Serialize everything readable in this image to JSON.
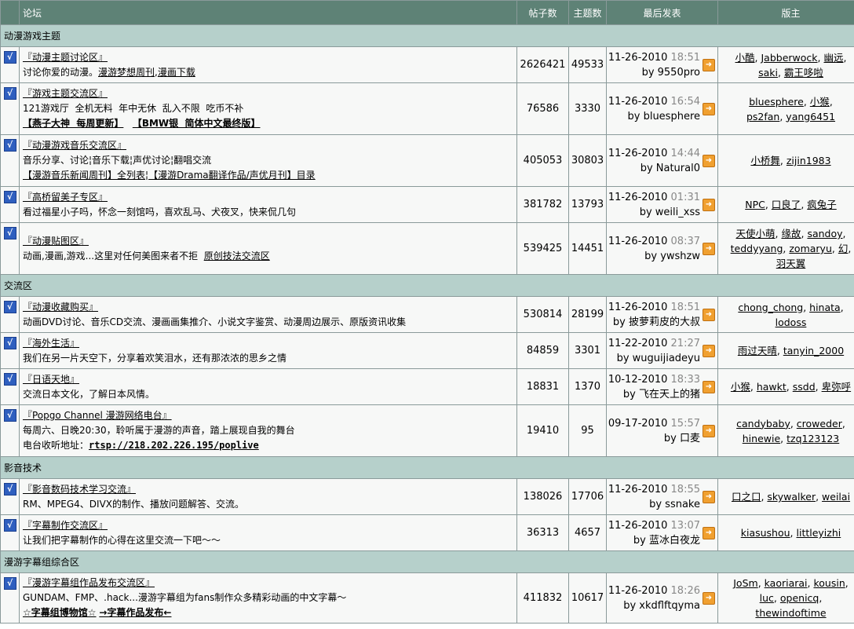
{
  "header": {
    "forum": "论坛",
    "posts": "帖子数",
    "topics": "主题数",
    "last_post": "最后发表",
    "moderators": "版主"
  },
  "sections": [
    {
      "title": "动漫游戏主题",
      "forums": [
        {
          "name": "『动漫主题讨论区』",
          "lines": [
            [
              {
                "t": "讨论你爱的动漫。"
              },
              {
                "t": "漫游梦想周刊",
                "link": true
              },
              {
                "t": ","
              },
              {
                "t": "漫画下载",
                "link": true
              }
            ]
          ],
          "posts": "2626421",
          "topics": "49533",
          "date": "11-26-2010",
          "time": "18:51",
          "by": "by 9550pro",
          "mods": [
            [
              "小酷",
              "Jabberwock",
              "幽远"
            ],
            [
              "saki",
              "霸王哆啦"
            ]
          ]
        },
        {
          "name": "『游戏主题交流区』",
          "lines": [
            [
              {
                "t": "121游戏厅  全机无料  年中无休  乱入不限  吃币不补"
              }
            ],
            [
              {
                "t": "【燕子大神  每周更新】",
                "style": "red"
              },
              {
                "t": "   "
              },
              {
                "t": "【BMW银  简体中文最终版】",
                "style": "blue"
              }
            ]
          ],
          "posts": "76586",
          "topics": "3330",
          "date": "11-26-2010",
          "time": "16:54",
          "by": "by bluesphere",
          "mods": [
            [
              "bluesphere",
              "小猴"
            ],
            [
              "ps2fan",
              "yang6451"
            ]
          ]
        },
        {
          "name": "『动漫游戏音乐交流区』",
          "lines": [
            [
              {
                "t": "音乐分享、讨论¦音乐下载¦声优讨论¦翻唱交流"
              }
            ],
            [
              {
                "t": "【漫游音乐新闻周刊】全列表",
                "link": true
              },
              {
                "t": "¦"
              },
              {
                "t": "【漫游Drama翻译作品/声优月刊】目录",
                "link": true
              }
            ]
          ],
          "posts": "405053",
          "topics": "30803",
          "date": "11-26-2010",
          "time": "14:44",
          "by": "by Natural0",
          "mods": [
            [
              "小桥舞",
              "zijin1983"
            ]
          ]
        },
        {
          "name": "『高桥留美子专区』",
          "lines": [
            [
              {
                "t": "看过福星小子吗，怀念一刻馆吗，喜欢乱马、犬夜叉，快来侃几句"
              }
            ]
          ],
          "posts": "381782",
          "topics": "13793",
          "date": "11-26-2010",
          "time": "01:31",
          "by": "by weili_xss",
          "mods": [
            [
              "NPC",
              "口良了",
              "疯兔子"
            ]
          ]
        },
        {
          "name": "『动漫贴图区』",
          "lines": [
            [
              {
                "t": "动画,漫画,游戏...这里对任何美图来者不拒  "
              },
              {
                "t": "原创技法交流区",
                "style": "darkred"
              }
            ]
          ],
          "posts": "539425",
          "topics": "14451",
          "date": "11-26-2010",
          "time": "08:37",
          "by": "by ywshzw",
          "mods": [
            [
              "天使小萌",
              "缘故",
              "sandoy"
            ],
            [
              "teddyyang",
              "zomaryu",
              "幻"
            ],
            [
              "羽天翼"
            ]
          ]
        }
      ]
    },
    {
      "title": "交流区",
      "forums": [
        {
          "name": "『动漫收藏购买』",
          "lines": [
            [
              {
                "t": "动画DVD讨论、音乐CD交流、漫画画集推介、小说文字鉴赏、动漫周边展示、原版资讯收集"
              }
            ]
          ],
          "posts": "530814",
          "topics": "28199",
          "date": "11-26-2010",
          "time": "18:51",
          "by": "by 披萝莉皮的大叔",
          "mods": [
            [
              "chong_chong",
              "hinata"
            ],
            [
              "lodoss"
            ]
          ]
        },
        {
          "name": "『海外生活』",
          "lines": [
            [
              {
                "t": "我们在另一片天空下，分享着欢笑泪水，还有那浓浓的思乡之情"
              }
            ]
          ],
          "posts": "84859",
          "topics": "3301",
          "date": "11-22-2010",
          "time": "21:27",
          "by": "by wuguijiadeyu",
          "mods": [
            [
              "雨过天晴",
              "tanyin_2000"
            ]
          ]
        },
        {
          "name": "『日语天地』",
          "lines": [
            [
              {
                "t": "交流日本文化，了解日本风情。"
              }
            ]
          ],
          "posts": "18831",
          "topics": "1370",
          "date": "10-12-2010",
          "time": "18:33",
          "by": "by 飞在天上的猪",
          "mods": [
            [
              "小猴",
              "hawkt",
              "ssdd",
              "卑弥呼"
            ]
          ]
        },
        {
          "name": "『Popgo Channel 漫游网络电台』",
          "lines": [
            [
              {
                "t": "每周六、日晚20:30，聆听属于漫游的声音，踏上展现自我的舞台"
              }
            ],
            [
              {
                "t": "电台收听地址："
              },
              {
                "t": "rtsp://218.202.226.195/poplive",
                "style": "pink"
              }
            ]
          ],
          "posts": "19410",
          "topics": "95",
          "date": "09-17-2010",
          "time": "15:57",
          "by": "by 口麦",
          "mods": [
            [
              "candybaby",
              "croweder"
            ],
            [
              "hinewie",
              "tzq123123"
            ]
          ]
        }
      ]
    },
    {
      "title": "影音技术",
      "forums": [
        {
          "name": "『影音数码技术学习交流』",
          "lines": [
            [
              {
                "t": "RM、MPEG4、DIVX的制作、播放问题解答、交流。"
              }
            ]
          ],
          "posts": "138026",
          "topics": "17706",
          "date": "11-26-2010",
          "time": "18:55",
          "by": "by ssnake",
          "mods": [
            [
              "口之口",
              "skywalker",
              "weilai"
            ]
          ]
        },
        {
          "name": "『字幕制作交流区』",
          "lines": [
            [
              {
                "t": "让我们把字幕制作的心得在这里交流一下吧～～"
              }
            ]
          ],
          "posts": "36313",
          "topics": "4657",
          "date": "11-26-2010",
          "time": "13:07",
          "by": "by 蓝冰白夜龙",
          "mods": [
            [
              "kiasushou",
              "littleyizhi"
            ]
          ]
        }
      ]
    },
    {
      "title": "漫游字幕组综合区",
      "forums": [
        {
          "name": "『漫游字幕组作品发布交流区』",
          "lines": [
            [
              {
                "t": "GUNDAM、FMP、.hack...漫游字幕组为fans制作众多精彩动画的中文字幕～"
              }
            ],
            [
              {
                "t": "☆字幕组博物馆☆",
                "style": "blue"
              },
              {
                "t": " "
              },
              {
                "t": "→字幕作品发布←",
                "style": "orange"
              }
            ]
          ],
          "posts": "411832",
          "topics": "10617",
          "date": "11-26-2010",
          "time": "18:26",
          "by": "by xkdflftqyma",
          "mods": [
            [
              "JoSm",
              "kaoriarai",
              "kousin"
            ],
            [
              "luc",
              "openicq"
            ],
            [
              "thewindoftime"
            ]
          ]
        }
      ]
    }
  ]
}
